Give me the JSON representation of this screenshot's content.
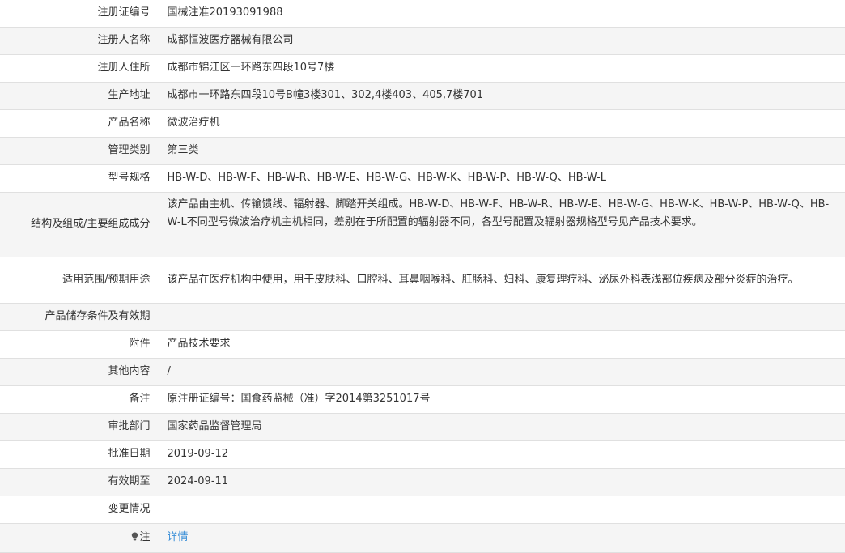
{
  "rows": [
    {
      "label": "注册证编号",
      "value": "国械注准20193091988"
    },
    {
      "label": "注册人名称",
      "value": "成都恒波医疗器械有限公司"
    },
    {
      "label": "注册人住所",
      "value": "成都市锦江区一环路东四段10号7楼"
    },
    {
      "label": "生产地址",
      "value": "成都市一环路东四段10号B幢3楼301、302,4楼403、405,7楼701"
    },
    {
      "label": "产品名称",
      "value": "微波治疗机"
    },
    {
      "label": "管理类别",
      "value": "第三类"
    },
    {
      "label": "型号规格",
      "value": "HB-W-D、HB-W-F、HB-W-R、HB-W-E、HB-W-G、HB-W-K、HB-W-P、HB-W-Q、HB-W-L"
    },
    {
      "label": "结构及组成/主要组成成分",
      "value": "该产品由主机、传输馈线、辐射器、脚踏开关组成。HB-W-D、HB-W-F、HB-W-R、HB-W-E、HB-W-G、HB-W-K、HB-W-P、HB-W-Q、HB-W-L不同型号微波治疗机主机相同，差别在于所配置的辐射器不同，各型号配置及辐射器规格型号见产品技术要求。"
    },
    {
      "label": "适用范围/预期用途",
      "value": "该产品在医疗机构中使用，用于皮肤科、口腔科、耳鼻咽喉科、肛肠科、妇科、康复理疗科、泌尿外科表浅部位疾病及部分炎症的治疗。"
    },
    {
      "label": "产品储存条件及有效期",
      "value": ""
    },
    {
      "label": "附件",
      "value": "产品技术要求"
    },
    {
      "label": "其他内容",
      "value": "/"
    },
    {
      "label": "备注",
      "value": "原注册证编号：国食药监械（准）字2014第3251017号"
    },
    {
      "label": "审批部门",
      "value": "国家药品监督管理局"
    },
    {
      "label": "批准日期",
      "value": "2019-09-12"
    },
    {
      "label": "有效期至",
      "value": "2024-09-11"
    },
    {
      "label": "变更情况",
      "value": ""
    }
  ],
  "note": {
    "label": "注",
    "link": "详情",
    "icon": "lightbulb-icon"
  },
  "colors": {
    "link": "#3a8fd8",
    "row_alt": "#f5f5f5",
    "border": "#e0e0e0"
  }
}
